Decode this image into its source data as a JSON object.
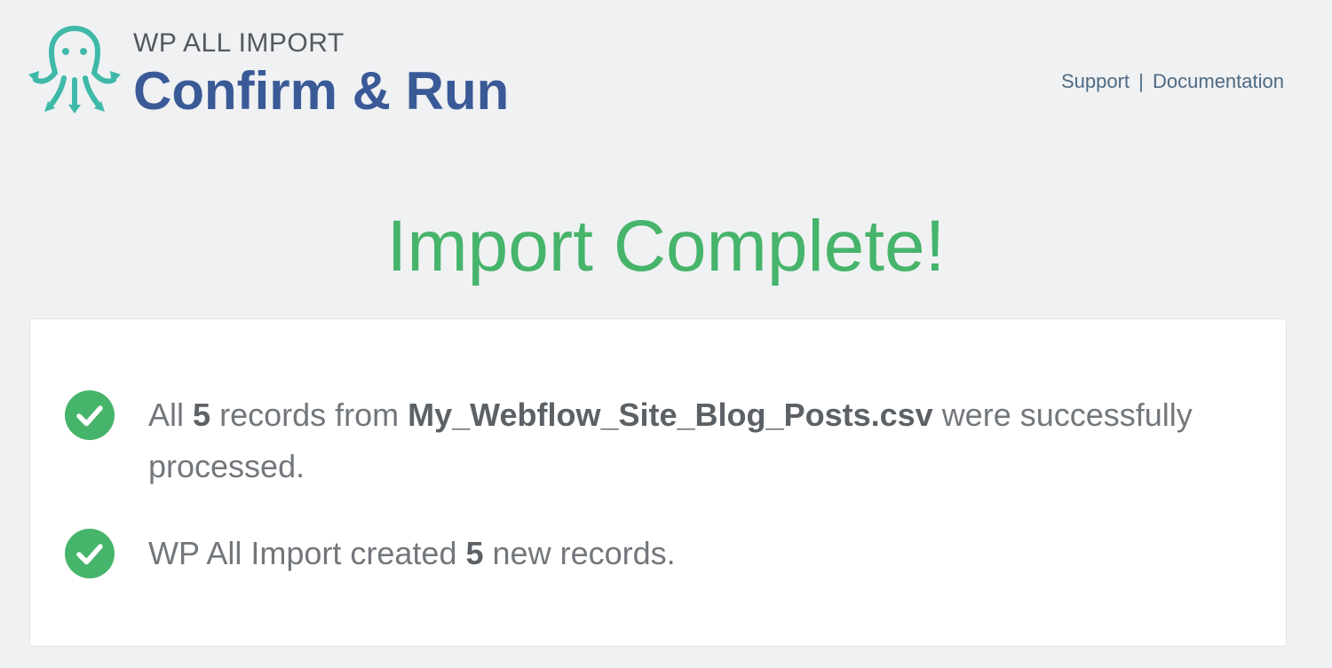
{
  "header": {
    "brand": "WP ALL IMPORT",
    "title": "Confirm & Run",
    "logo_icon": "octopus-logo-icon",
    "brand_color": "#3a5a97",
    "logo_color": "#3fb9a8",
    "links": {
      "support": "Support",
      "separator": "|",
      "documentation": "Documentation"
    }
  },
  "main": {
    "heading": "Import Complete!",
    "heading_color": "#46b46a",
    "results": [
      {
        "icon": "check-circle-icon",
        "prefix": "All",
        "count": "5",
        "middle": "records from",
        "filename": "My_Webflow_Site_Blog_Posts.csv",
        "suffix": "were successfully processed."
      },
      {
        "icon": "check-circle-icon",
        "prefix": "WP All Import created",
        "count": "5",
        "suffix": "new records."
      }
    ]
  }
}
